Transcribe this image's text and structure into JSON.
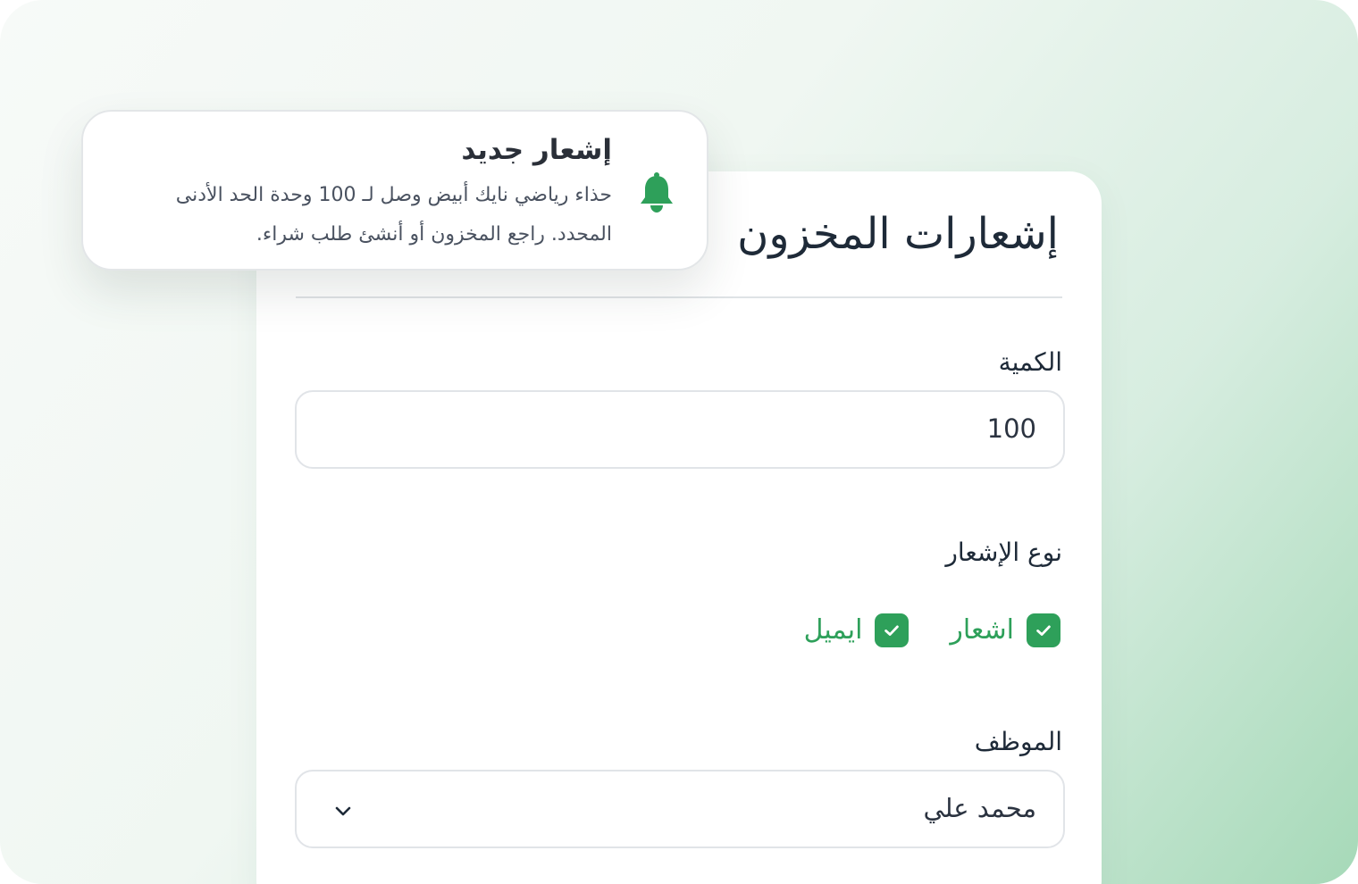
{
  "toast": {
    "title": "إشعار جديد",
    "body": "حذاء رياضي نايك أبيض وصل لـ 100 وحدة الحد الأدنى المحدد. راجع المخزون أو أنشئ طلب شراء.",
    "icon": "bell-icon",
    "accent": "#2ea05a"
  },
  "panel": {
    "title": "إشعارات المخزون",
    "quantity": {
      "label": "الكمية",
      "value": "100"
    },
    "notification_type": {
      "label": "نوع الإشعار",
      "options": [
        {
          "label": "اشعار",
          "checked": true
        },
        {
          "label": "ايميل",
          "checked": true
        }
      ]
    },
    "employee": {
      "label": "الموظف",
      "value": "محمد علي",
      "icon": "chevron-down-icon"
    }
  },
  "colors": {
    "accent": "#2ea05a",
    "text": "#1e2a38"
  }
}
